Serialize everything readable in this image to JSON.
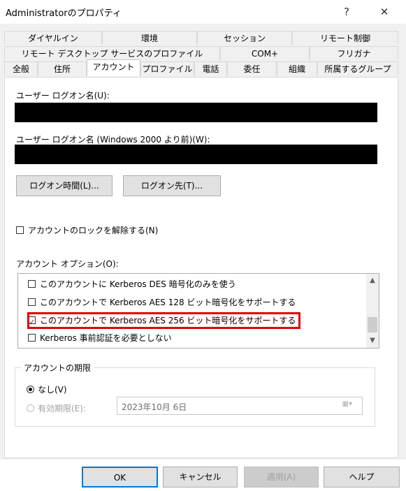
{
  "window": {
    "title": "Administratorのプロパティ",
    "help_glyph": "?",
    "close_glyph": "✕"
  },
  "tabs": {
    "row1": [
      "ダイヤルイン",
      "環境",
      "セッション",
      "リモート制御"
    ],
    "row2": [
      "リモート デスクトップ サービスのプロファイル",
      "COM+",
      "フリガナ"
    ],
    "row3": [
      "全般",
      "住所",
      "アカウント",
      "プロファイル",
      "電話",
      "委任",
      "組織",
      "所属するグループ"
    ],
    "active": "アカウント"
  },
  "account": {
    "logon_name_label": "ユーザー ログオン名(U):",
    "logon_name_pre2000_label": "ユーザー ログオン名 (Windows 2000 より前)(W):",
    "logon_hours_button": "ログオン時間(L)...",
    "logon_to_button": "ログオン先(T)...",
    "unlock_label": "アカウントのロックを解除する(N)",
    "options_label": "アカウント オプション(O):",
    "options": [
      {
        "label": "このアカウントに Kerberos DES 暗号化のみを使う",
        "checked": false
      },
      {
        "label": "このアカウントで Kerberos AES 128 ビット暗号化をサポートする",
        "checked": false
      },
      {
        "label": "このアカウントで Kerberos AES 256 ビット暗号化をサポートする",
        "checked": true
      },
      {
        "label": "Kerberos 事前認証を必要としない",
        "checked": false
      }
    ],
    "expiry": {
      "title": "アカウントの期限",
      "never_label": "なし(V)",
      "end_of_label": "有効期限(E):",
      "date_value": "2023年10月  6日",
      "selected": "never"
    }
  },
  "footer": {
    "ok": "OK",
    "cancel": "キャンセル",
    "apply": "適用(A)",
    "help": "ヘルプ"
  },
  "colors": {
    "highlight": "#e00000",
    "disabled_text": "#a0a0a0",
    "ok_border": "#0078d7"
  }
}
